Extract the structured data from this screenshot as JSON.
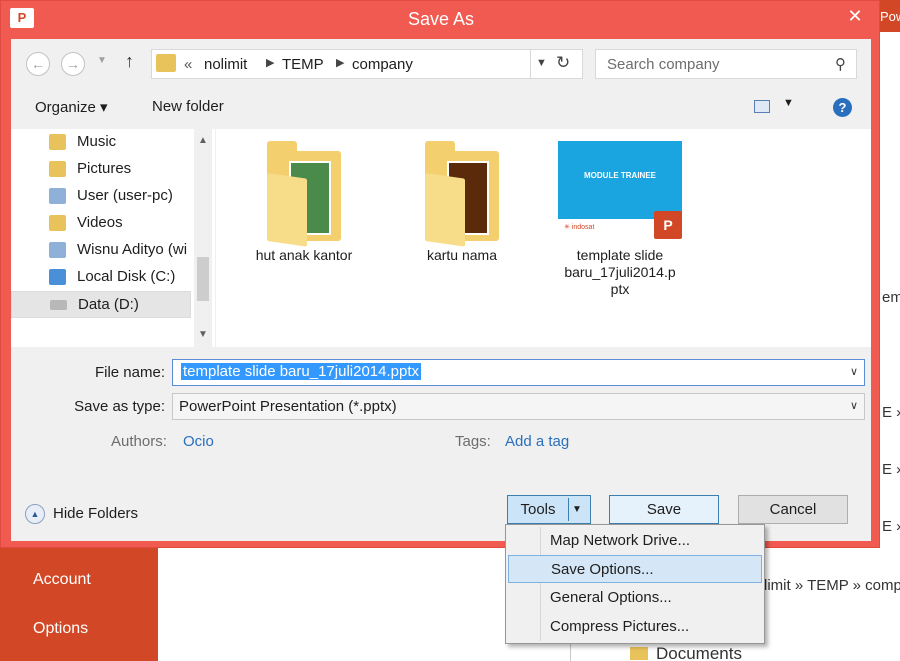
{
  "background": {
    "nav_items": [
      "Account",
      "Options"
    ],
    "top_right_text": "Pow",
    "side_fragments": [
      "emp",
      "E »",
      "E »",
      "E »"
    ],
    "path_fragment": "limit » TEMP » comp",
    "documents_label": "Documents"
  },
  "dialog": {
    "title": "Save As",
    "app_icon": "P",
    "close_glyph": "✕",
    "address": {
      "prefix": "«",
      "crumbs": [
        "nolimit",
        "TEMP",
        "company"
      ]
    },
    "search_placeholder": "Search company",
    "toolbar": {
      "organize": "Organize ▾",
      "new_folder": "New folder"
    },
    "nav_pane": {
      "items": [
        {
          "label": "Music",
          "icon": "music-folder-icon"
        },
        {
          "label": "Pictures",
          "icon": "pictures-folder-icon"
        },
        {
          "label": "User (user-pc)",
          "icon": "network-computer-icon"
        },
        {
          "label": "Videos",
          "icon": "videos-folder-icon"
        },
        {
          "label": "Wisnu Adityo (wi",
          "icon": "network-computer-icon"
        },
        {
          "label": "Local Disk (C:)",
          "icon": "disk-icon"
        },
        {
          "label": "Data (D:)",
          "icon": "drive-icon",
          "selected": true
        }
      ]
    },
    "files": [
      {
        "label": "hut anak kantor",
        "kind": "folder"
      },
      {
        "label": "kartu nama",
        "kind": "folder"
      },
      {
        "label_lines": [
          "template slide",
          "baru_17juli2014.p",
          "ptx"
        ],
        "kind": "pptx",
        "thumb_title": "MODULE TRAINEE",
        "thumb_brand": "✳ indosat"
      }
    ],
    "form": {
      "file_name_label": "File name:",
      "file_name_value": "template slide baru_17juli2014.pptx",
      "save_type_label": "Save as type:",
      "save_type_value": "PowerPoint Presentation (*.pptx)",
      "authors_label": "Authors:",
      "authors_value": "Ocio",
      "tags_label": "Tags:",
      "tags_value": "Add a tag"
    },
    "hide_folders": "Hide Folders",
    "buttons": {
      "tools": "Tools",
      "save": "Save",
      "cancel": "Cancel"
    },
    "tools_menu": [
      "Map Network Drive...",
      "Save Options...",
      "General Options...",
      "Compress Pictures..."
    ],
    "tools_menu_highlighted": "Save Options..."
  },
  "colors": {
    "accent_red": "#f05a50",
    "office_orange": "#d24726",
    "selection_blue": "#3399ff"
  }
}
